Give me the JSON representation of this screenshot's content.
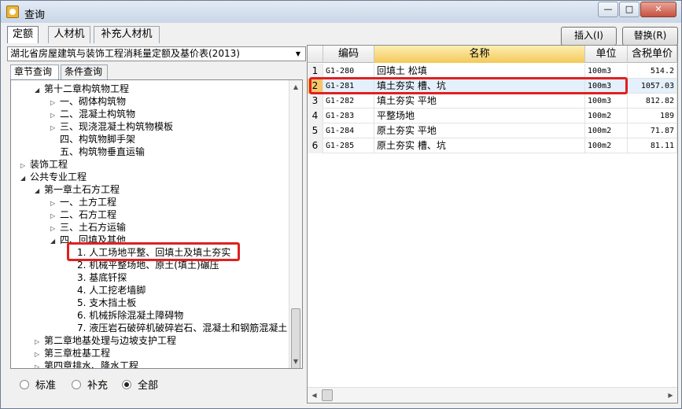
{
  "window": {
    "title": "查询",
    "controls": {
      "minimize": "—",
      "maximize": "□",
      "close": "✕"
    }
  },
  "tabs": [
    "定额",
    "人材机",
    "补充人材机"
  ],
  "actions": {
    "insert": "插入(I)",
    "replace": "替换(R)"
  },
  "left": {
    "quota_library": "湖北省房屋建筑与装饰工程消耗量定额及基价表(2013)",
    "subtabs": [
      "章节查询",
      "条件查询"
    ],
    "tree": [
      {
        "exp": "◢",
        "label": "第十二章构筑物工程"
      },
      {
        "exp": "▷",
        "label": "一、砌体构筑物"
      },
      {
        "exp": "▷",
        "label": "二、混凝土构筑物"
      },
      {
        "exp": "▷",
        "label": "三、现浇混凝土构筑物模板"
      },
      {
        "exp": "",
        "label": "四、构筑物脚手架"
      },
      {
        "exp": "",
        "label": "五、构筑物垂直运输"
      },
      {
        "exp": "▷",
        "label": "装饰工程"
      },
      {
        "exp": "◢",
        "label": "公共专业工程"
      },
      {
        "exp": "◢",
        "label": "第一章土石方工程"
      },
      {
        "exp": "▷",
        "label": "一、土方工程"
      },
      {
        "exp": "▷",
        "label": "二、石方工程"
      },
      {
        "exp": "▷",
        "label": "三、土石方运输"
      },
      {
        "exp": "◢",
        "label": "四、回填及其他"
      },
      {
        "exp": "",
        "label": "1. 人工场地平整、回填土及填土夯实"
      },
      {
        "exp": "",
        "label": "2. 机械平整场地、原土(填土)碾压"
      },
      {
        "exp": "",
        "label": "3. 基底钎探"
      },
      {
        "exp": "",
        "label": "4. 人工挖老墙脚"
      },
      {
        "exp": "",
        "label": "5. 支木挡土板"
      },
      {
        "exp": "",
        "label": "6. 机械拆除混凝土障碍物"
      },
      {
        "exp": "",
        "label": "7. 液压岩石破碎机破碎岩石、混凝土和钢筋混凝土"
      },
      {
        "exp": "▷",
        "label": "第二章地基处理与边坡支护工程"
      },
      {
        "exp": "▷",
        "label": "第三章桩基工程"
      },
      {
        "exp": "▷",
        "label": "第四章排水、降水工程"
      }
    ],
    "filter": {
      "standard": "标准",
      "supplement": "补充",
      "all": "全部",
      "selected": "all"
    }
  },
  "grid": {
    "headers": [
      "编码",
      "名称",
      "单位",
      "含税单价"
    ],
    "rows": [
      {
        "no": "1",
        "code": "G1-280",
        "name": "回填土 松填",
        "unit": "100m3",
        "price": "514.2"
      },
      {
        "no": "2",
        "code": "G1-281",
        "name": "填土夯实 槽、坑",
        "unit": "100m3",
        "price": "1057.03"
      },
      {
        "no": "3",
        "code": "G1-282",
        "name": "填土夯实 平地",
        "unit": "100m3",
        "price": "812.82"
      },
      {
        "no": "4",
        "code": "G1-283",
        "name": "平整场地",
        "unit": "100m2",
        "price": "189"
      },
      {
        "no": "5",
        "code": "G1-284",
        "name": "原土夯实 平地",
        "unit": "100m2",
        "price": "71.87"
      },
      {
        "no": "6",
        "code": "G1-285",
        "name": "原土夯实 槽、坑",
        "unit": "100m2",
        "price": "81.11"
      }
    ]
  }
}
